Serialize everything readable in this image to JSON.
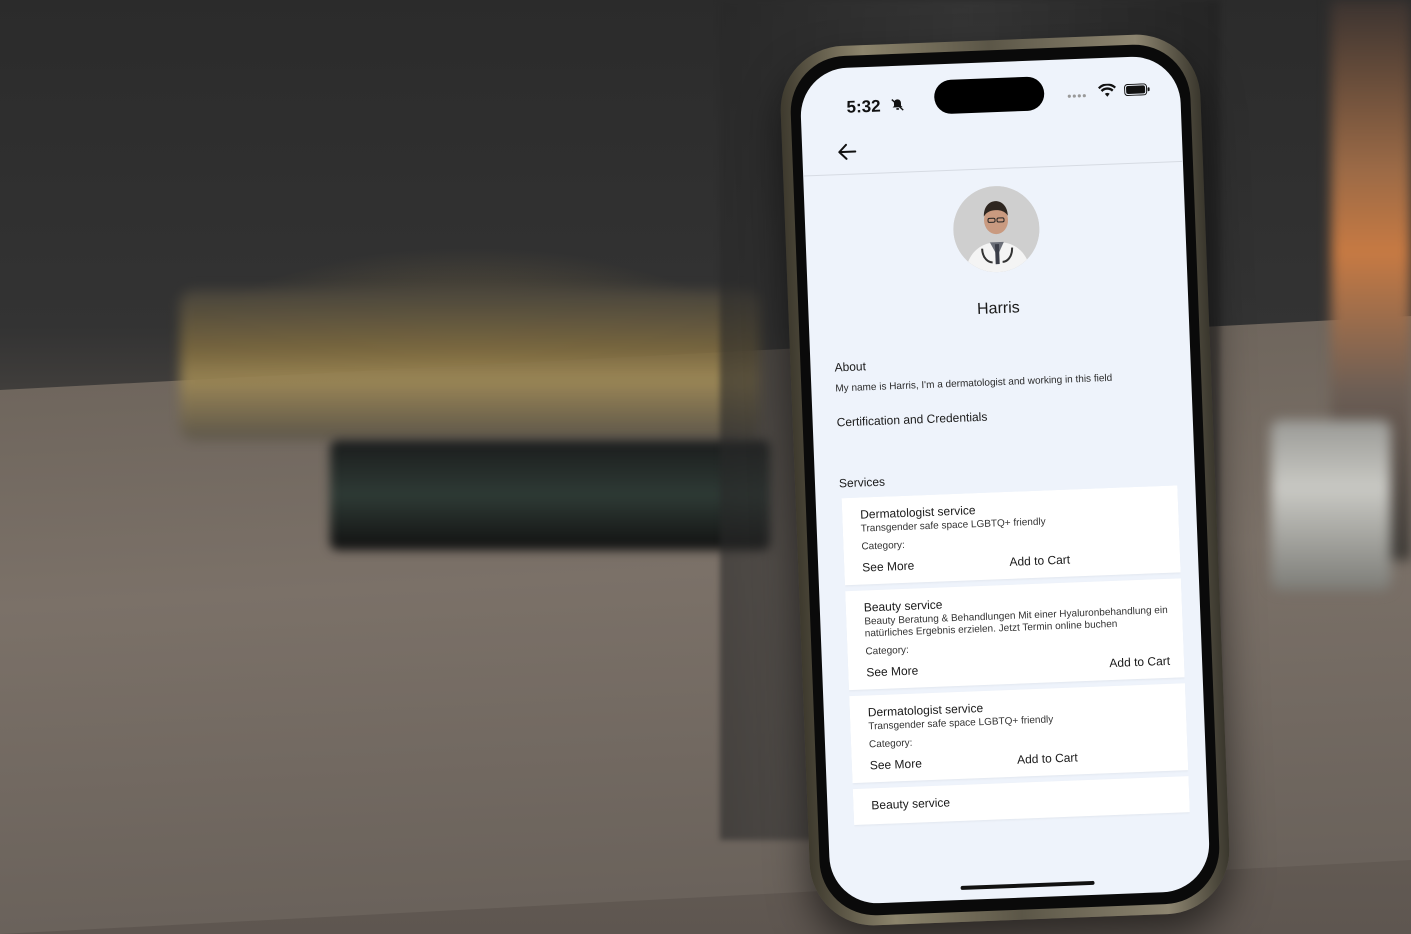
{
  "status_bar": {
    "time": "5:32",
    "icons": [
      "bell-slash-icon",
      "signal-dots-icon",
      "wifi-icon",
      "battery-icon"
    ]
  },
  "nav": {
    "back_icon": "arrow-left-icon"
  },
  "profile": {
    "name": "Harris",
    "avatar": "doctor-avatar"
  },
  "about": {
    "title": "About",
    "text": "My name is Harris, I'm a dermatologist and working in this field"
  },
  "certification": {
    "title": "Certification and Credentials"
  },
  "services": {
    "title": "Services",
    "items": [
      {
        "title": "Dermatologist service",
        "description": "Transgender safe space LGBTQ+ friendly",
        "category_label": "Category:",
        "see_more": "See More",
        "add_to_cart": "Add to Cart"
      },
      {
        "title": "Beauty service",
        "description": "Beauty Beratung & Behandlungen Mit einer Hyaluronbehandlung ein natürliches Ergebnis erzielen. Jetzt Termin online buchen",
        "category_label": "Category:",
        "see_more": "See More",
        "add_to_cart": "Add to Cart"
      },
      {
        "title": "Dermatologist service",
        "description": "Transgender safe space LGBTQ+ friendly",
        "category_label": "Category:",
        "see_more": "See More",
        "add_to_cart": "Add to Cart"
      },
      {
        "title": "Beauty service"
      }
    ]
  }
}
